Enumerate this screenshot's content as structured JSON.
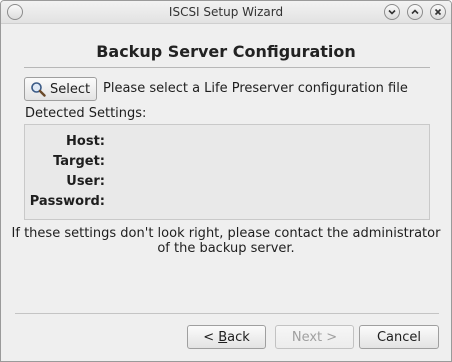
{
  "window": {
    "title": "ISCSI Setup Wizard"
  },
  "page": {
    "heading": "Backup Server Configuration",
    "select_button_label": "Select",
    "instruction": "Please select a Life Preserver configuration file",
    "detected_label": "Detected Settings:",
    "settings": {
      "host_label": "Host:",
      "target_label": "Target:",
      "user_label": "User:",
      "password_label": "Password:"
    },
    "note_line1": "If these settings don't look right, please contact the administrator",
    "note_line2": "of the backup server."
  },
  "footer": {
    "back_prefix": "< ",
    "back_mnemonic": "B",
    "back_rest": "ack",
    "next_label": "Next >",
    "next_enabled": false,
    "cancel_label": "Cancel"
  },
  "icons": {
    "window_menu": "circle-icon",
    "minimize": "chevron-down-icon",
    "maximize": "chevron-up-icon",
    "close": "close-icon",
    "select": "magnifier-icon"
  }
}
